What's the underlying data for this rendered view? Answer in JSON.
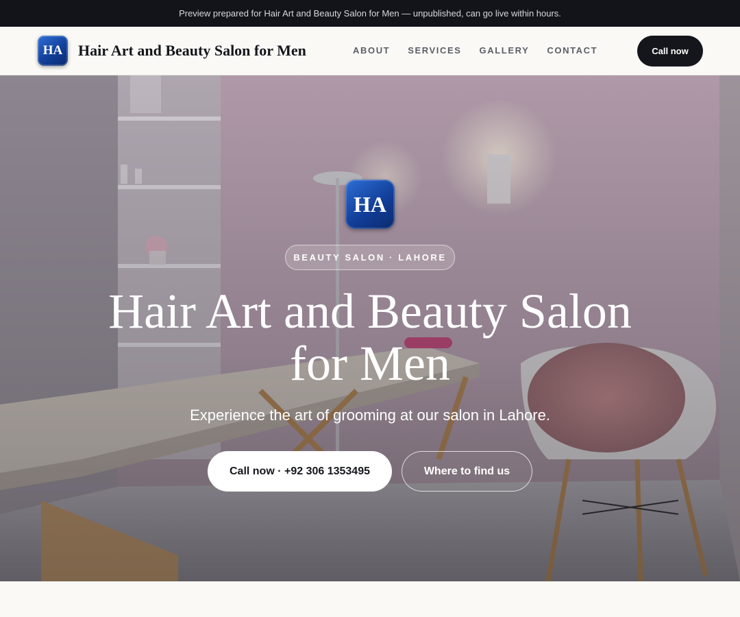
{
  "topbar": {
    "text": "Preview prepared for Hair Art and Beauty Salon for Men — unpublished, can go live within hours."
  },
  "nav": {
    "logo_text": "HA",
    "brand_name": "Hair Art and Beauty Salon for Men",
    "links": [
      "ABOUT",
      "SERVICES",
      "GALLERY",
      "CONTACT"
    ],
    "cta_label": "Call now"
  },
  "hero": {
    "logo_text": "HA",
    "eyebrow": "BEAUTY SALON · LAHORE",
    "title": "Hair Art and Beauty Salon for Men",
    "subtitle": "Experience the art of grooming at our salon in Lahore.",
    "primary_button": "Call now · +92 306 1353495",
    "secondary_button": "Where to find us",
    "background_icon": "salon-interior-photo"
  },
  "colors": {
    "dark": "#14161b",
    "topbar_bg": "#12141a",
    "page_bg": "#faf9f6",
    "brand_blue": "#123f9a"
  }
}
